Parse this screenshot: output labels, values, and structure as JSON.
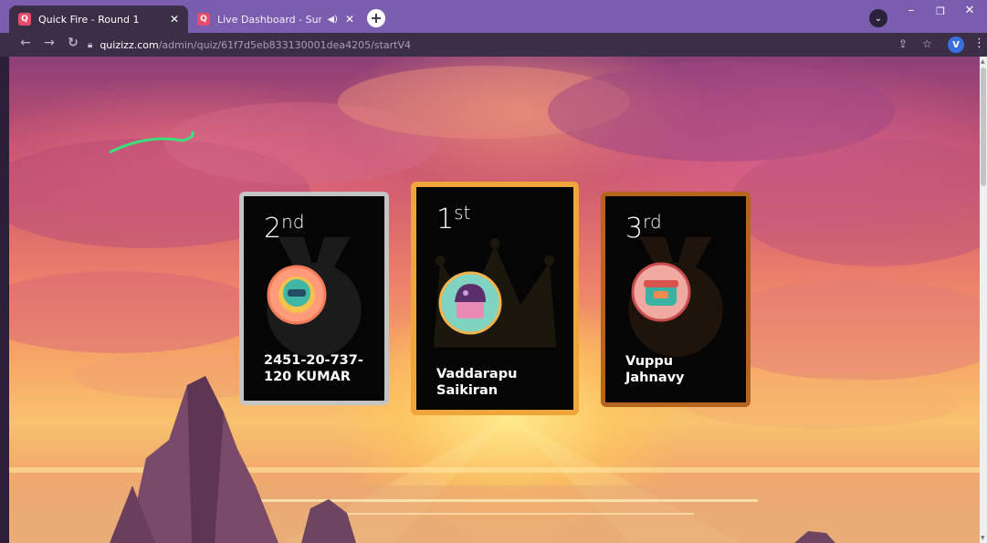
{
  "browser": {
    "tabs": [
      {
        "title": "Quick Fire - Round 1",
        "active": true
      },
      {
        "title": "Live Dashboard - Summary",
        "active": false
      }
    ],
    "url": {
      "host": "quizizz.com",
      "path": "/admin/quiz/61f7d5eb833130001dea4205/startV4"
    },
    "profile_initial": "V",
    "icons": [
      "back-icon",
      "forward-icon",
      "reload-icon",
      "lock-icon",
      "share-icon",
      "star-icon",
      "menu-icon",
      "audio-icon",
      "close-icon",
      "plus-icon",
      "chevron-down-icon",
      "minimize-icon",
      "restore-icon"
    ]
  },
  "podium": [
    {
      "rank": "2",
      "suffix": "nd",
      "name": "2451-20-737-\n120 KUMAR",
      "line1": "2451-20-737-",
      "line2": "120 KUMAR",
      "border": "#c4c4c4"
    },
    {
      "rank": "1",
      "suffix": "st",
      "name": "Vaddarapu Saikiran",
      "line1": "Vaddarapu",
      "line2": "Saikiran",
      "border": "#f0a53a"
    },
    {
      "rank": "3",
      "suffix": "rd",
      "name": "Vuppu Jahnavy",
      "line1": "Vuppu",
      "line2": "Jahnavy",
      "border": "#b5651d"
    }
  ],
  "colors": {
    "tab_bar": "#7b5db0",
    "toolbar": "#3a2f47",
    "silver": "#c4c4c4",
    "gold": "#f0a53a",
    "bronze": "#b5651d"
  }
}
